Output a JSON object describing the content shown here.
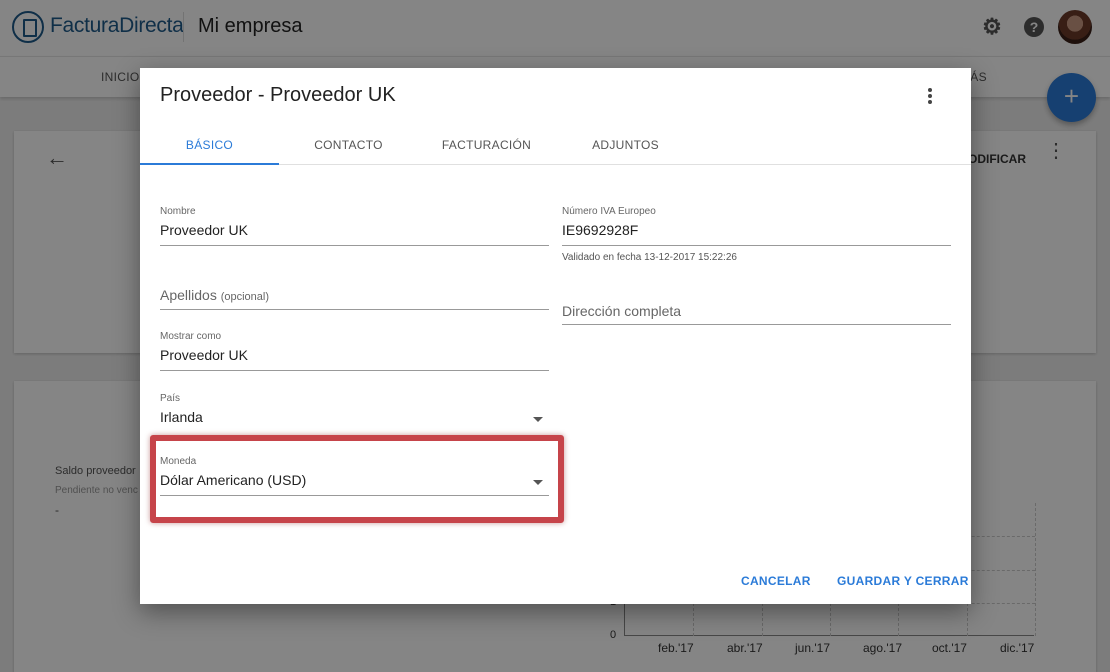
{
  "app": {
    "brand": "FacturaDirecta",
    "company": "Mi empresa",
    "nav": {
      "inicio": "INICIO",
      "mas": "MÁS"
    },
    "card": {
      "modify_label": "MODIFICAR"
    },
    "balance": {
      "label": "Saldo proveedor",
      "sub": "Pendiente no venc",
      "value": "-"
    },
    "icons": [
      "gear-icon",
      "help-icon",
      "avatar",
      "back-arrow-icon",
      "more-vert-icon",
      "add-icon"
    ]
  },
  "chart_data": {
    "type": "line",
    "categories": [
      "feb.'17",
      "abr.'17",
      "jun.'17",
      "ago.'17",
      "oct.'17",
      "dic.'17"
    ],
    "y_ticks": [
      "0",
      "1"
    ],
    "values": [
      0,
      0,
      0,
      0,
      0,
      0
    ]
  },
  "dialog": {
    "title": "Proveedor - Proveedor UK",
    "tabs": [
      {
        "label": "BÁSICO",
        "active": true
      },
      {
        "label": "CONTACTO",
        "active": false
      },
      {
        "label": "FACTURACIÓN",
        "active": false
      },
      {
        "label": "ADJUNTOS",
        "active": false
      }
    ],
    "fields": {
      "nombre": {
        "label": "Nombre",
        "value": "Proveedor UK"
      },
      "apellidos": {
        "placeholder": "Apellidos",
        "optional": "(opcional)"
      },
      "mostrar_como": {
        "label": "Mostrar como",
        "value": "Proveedor UK"
      },
      "pais": {
        "label": "País",
        "value": "Irlanda"
      },
      "moneda": {
        "label": "Moneda",
        "value": "Dólar Americano (USD)"
      },
      "iva": {
        "label": "Número IVA Europeo",
        "value": "IE9692928F",
        "hint": "Validado en fecha 13-12-2017 15:22:26"
      },
      "direccion": {
        "placeholder": "Dirección completa"
      }
    },
    "buttons": {
      "cancel": "CANCELAR",
      "save": "GUARDAR Y CERRAR"
    },
    "highlight_color": "#c6444a",
    "accent_color": "#2b7bd8"
  }
}
